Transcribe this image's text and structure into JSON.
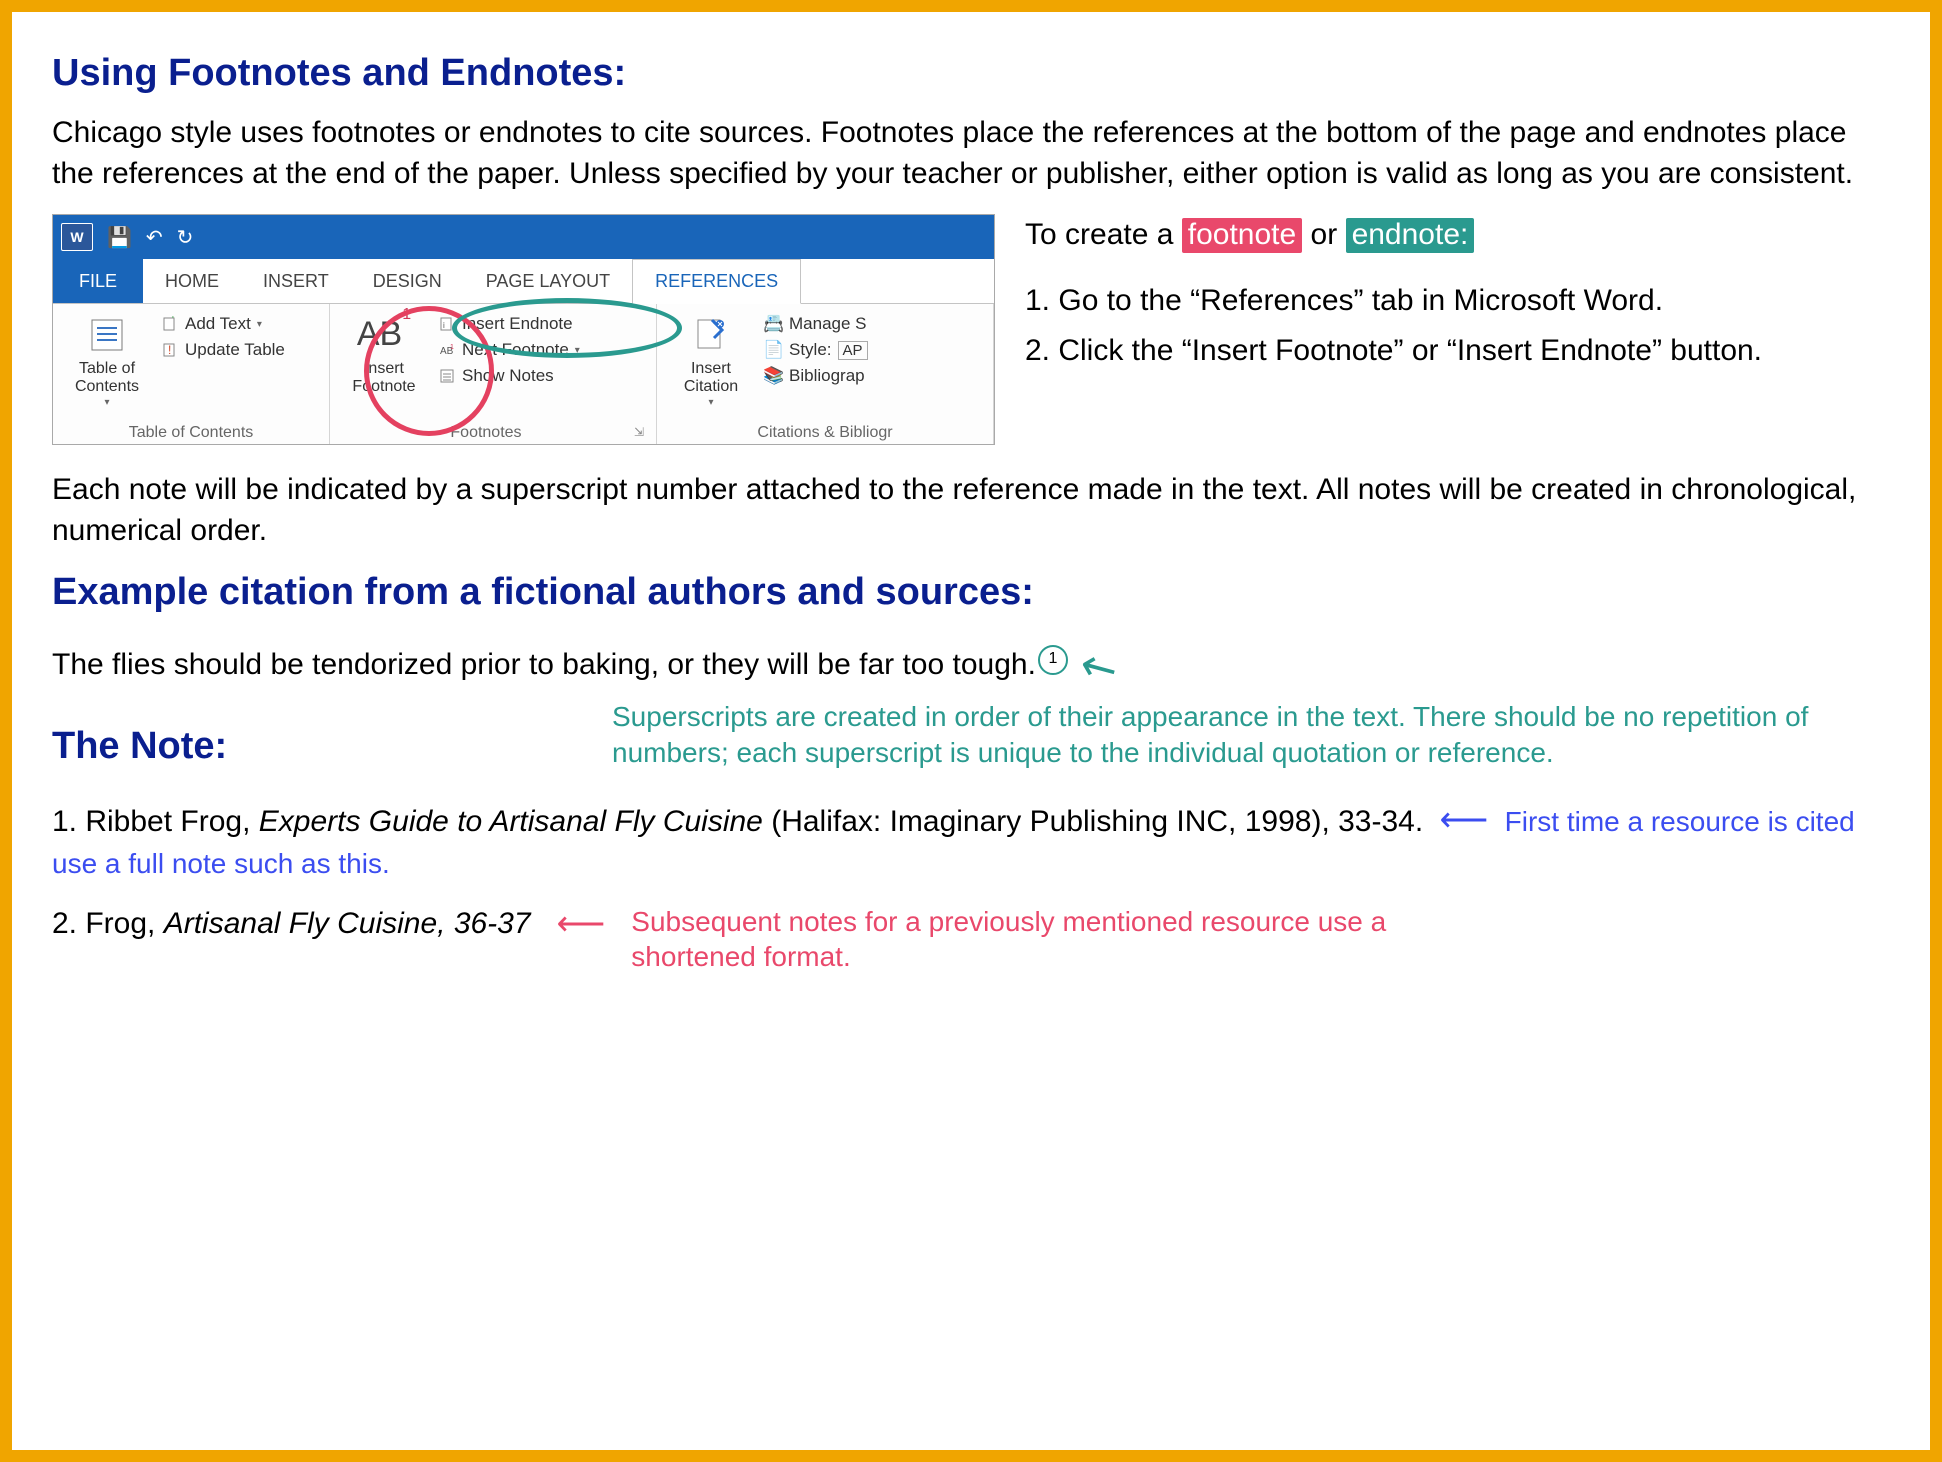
{
  "headings": {
    "using": "Using Footnotes and Endnotes:",
    "example": "Example citation from a fictional authors and sources:",
    "the_note": "The Note:"
  },
  "paragraphs": {
    "intro": "Chicago style uses footnotes or endnotes to cite sources.  Footnotes place the references at the bottom of the page and endnotes place the references at the end of the paper.  Unless specified by your teacher or publisher, either option is valid as long as you are consistent.",
    "after_ribbon": "Each note will be indicated by a superscript number attached to the reference made in the text. All notes will be created in chronological, numerical order.",
    "example_sentence": "The flies should be tendorized prior to baking, or they will be far too tough."
  },
  "instructions": {
    "lead_pre": "To create a ",
    "pill1": "footnote",
    "mid": " or ",
    "pill2": "endnote:",
    "step1": "1. Go to the “References” tab in Micro­soft Word.",
    "step2": "2. Click the “Insert Footnote” or “Insert Endnote” button."
  },
  "ribbon": {
    "word_badge": "W",
    "tabs": {
      "file": "FILE",
      "home": "HOME",
      "insert": "INSERT",
      "design": "DESIGN",
      "page_layout": "PAGE LAYOUT",
      "references": "REFERENCES"
    },
    "groups": {
      "toc": {
        "big": "Table of Contents",
        "add_text": "Add Text",
        "update_table": "Update Table",
        "label": "Table of Contents"
      },
      "footnotes": {
        "ab": "AB",
        "ab_sup": "1",
        "insert_footnote": "Insert Footnote",
        "insert_endnote": "Insert Endnote",
        "next_footnote": "Next Footnote",
        "show_notes": "Show Notes",
        "label": "Footnotes"
      },
      "citations": {
        "big": "Insert Citation",
        "manage": "Manage S",
        "style": "Style:",
        "style_val": "AP",
        "biblio": "Bibliograp",
        "label": "Citations & Bibliogr"
      }
    }
  },
  "annotations": {
    "superscript_marker": "1",
    "teal_explain": "Superscripts are created in order of their appearance in the text. There should be no repetition of numbers; each superscript is unique to the individual quotation or reference.",
    "note1_pre": "1. Ribbet Frog, ",
    "note1_title": "Experts Guide to Artisanal Fly Cuisine",
    "note1_post": " (Halifax: Imaginary Publishing INC, 1998), 33-34.",
    "blue_text": "First time a resource is cited use a full note such as this.",
    "note2_pre": "2. Frog, ",
    "note2_title": "Artisanal Fly Cuisine, 36-37",
    "pink_text": "Subsequent notes for a previously mentioned resource use a shortened format."
  }
}
